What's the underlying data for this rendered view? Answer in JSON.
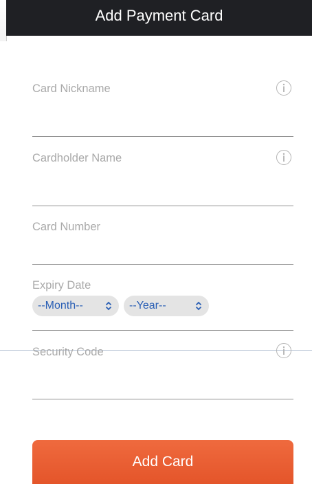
{
  "header": {
    "title": "Add Payment Card"
  },
  "form": {
    "card_nickname": {
      "label": "Card Nickname",
      "info_icon": "info-icon"
    },
    "cardholder_name": {
      "label": "Cardholder Name",
      "info_icon": "info-icon"
    },
    "card_number": {
      "label": "Card Number"
    },
    "expiry_date": {
      "label": "Expiry Date",
      "month_select": "--Month--",
      "year_select": "--Year--"
    },
    "security_code": {
      "label": "Security Code",
      "info_icon": "info-icon"
    }
  },
  "actions": {
    "add_card_label": "Add Card"
  },
  "colors": {
    "header_bg": "#1f2024",
    "button_bg": "#e85d31",
    "select_text": "#2a5fb5",
    "label_text": "#a9a9a9"
  }
}
